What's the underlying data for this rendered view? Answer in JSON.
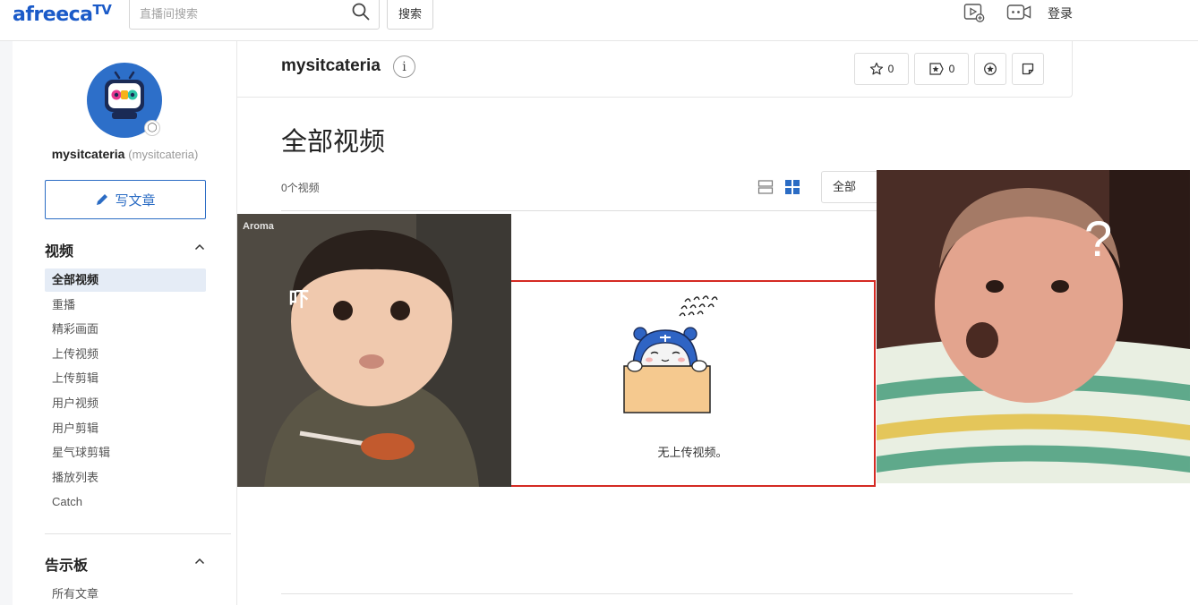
{
  "header": {
    "logo_main": "afreeca",
    "logo_tv": "TV",
    "search_placeholder": "直播间搜索",
    "search_button": "搜索",
    "login_label": "登录"
  },
  "sidebar": {
    "profile_name": "mysitcateria",
    "profile_id": "(mysitcateria)",
    "write_button": "写文章",
    "video_section_title": "视频",
    "video_items": [
      {
        "label": "全部视频",
        "active": true
      },
      {
        "label": "重播"
      },
      {
        "label": "精彩画面"
      },
      {
        "label": "上传视频"
      },
      {
        "label": "上传剪辑"
      },
      {
        "label": "用户视频"
      },
      {
        "label": "用户剪辑"
      },
      {
        "label": "星气球剪辑"
      },
      {
        "label": "播放列表"
      },
      {
        "label": "Catch"
      }
    ],
    "board_section_title": "告示板",
    "board_items": [
      {
        "label": "所有文章"
      }
    ]
  },
  "channel": {
    "name": "mysitcateria",
    "info_label": "i",
    "favorite_count": "0",
    "subscribe_count": "0"
  },
  "main": {
    "title": "全部视频",
    "video_count": "0个视频",
    "filter_value": "全部",
    "empty_message": "无上传视频。"
  },
  "overlays": {
    "left_watermark": "Aroma",
    "left_caption": "吓",
    "right_caption": "?"
  },
  "colors": {
    "brand_blue": "#1a5ac8",
    "accent_blue": "#2b6cc4",
    "active_nav_bg": "#e5ecf6",
    "empty_border": "#d42a23"
  }
}
